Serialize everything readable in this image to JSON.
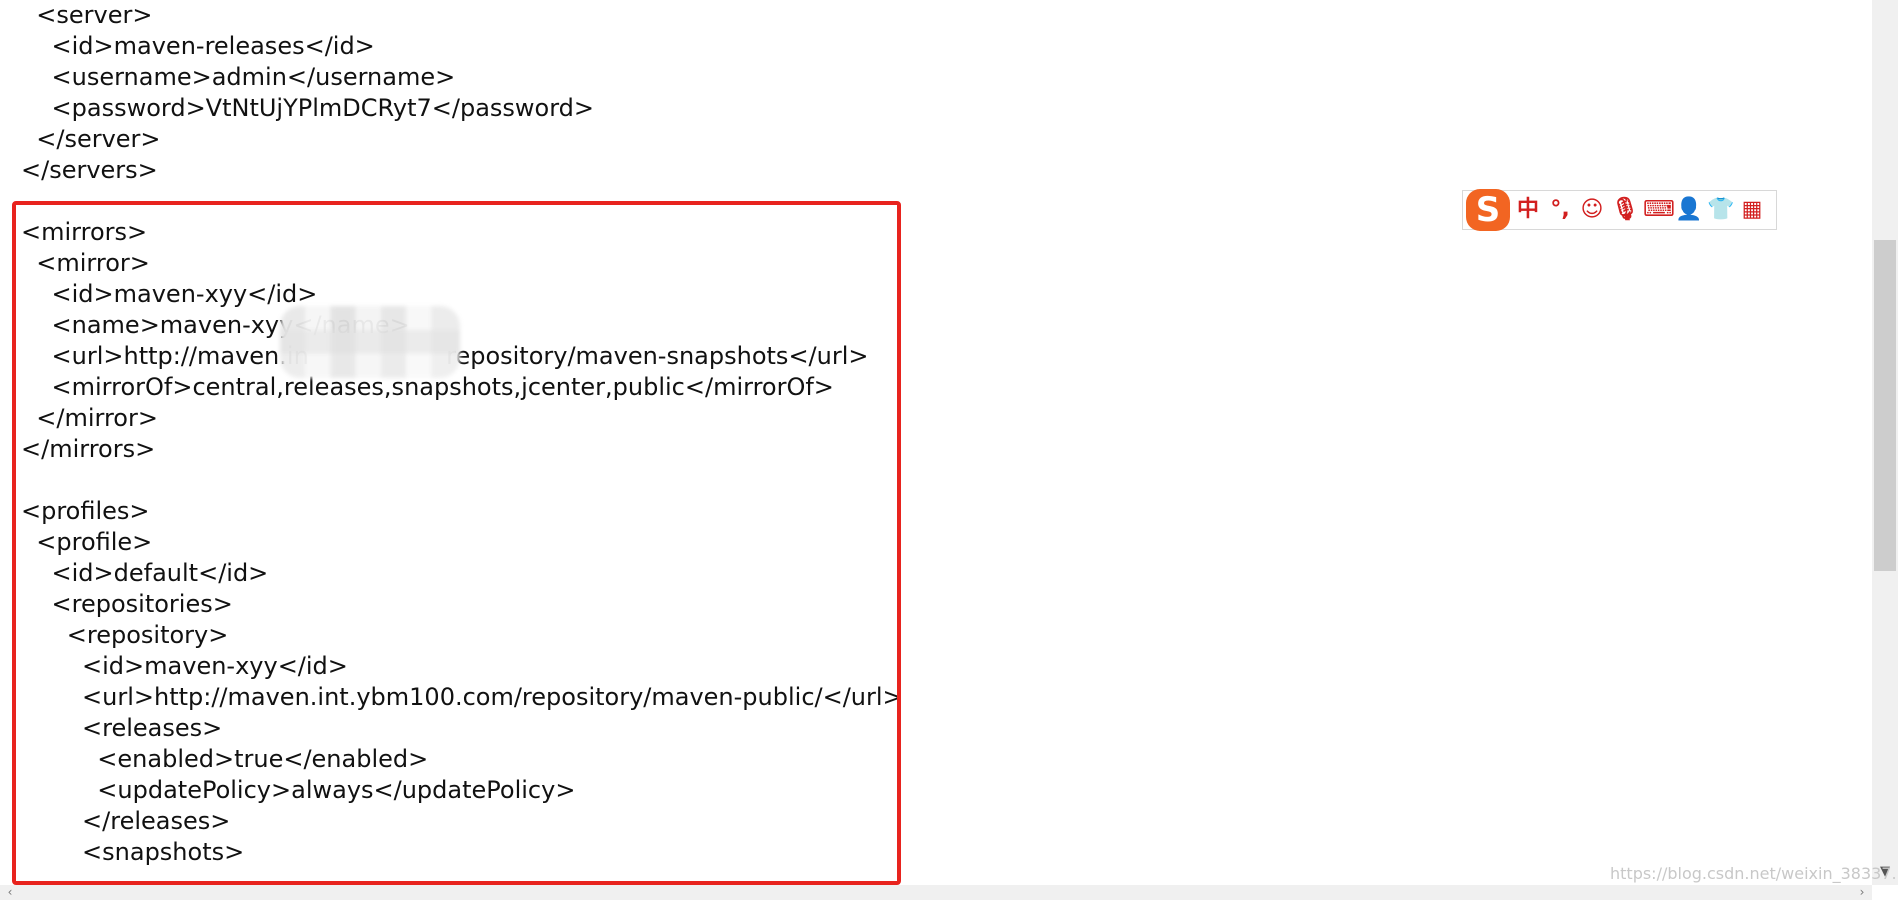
{
  "editor": {
    "lines": [
      "  <server>",
      "    <id>maven-releases</id>",
      "    <username>admin</username>",
      "    <password>VtNtUjYPlmDCRyt7</password>",
      "  </server>",
      "</servers>",
      "",
      "<mirrors>",
      "  <mirror>",
      "    <id>maven-xyy</id>",
      "    <name>maven-xyy</name>",
      "    <url>http://maven.in                  repository/maven-snapshots</url>",
      "    <mirrorOf>central,releases,snapshots,jcenter,public</mirrorOf>",
      "  </mirror>",
      "</mirrors>",
      "",
      "<profiles>",
      "  <profile>",
      "    <id>default</id>",
      "    <repositories>",
      "      <repository>",
      "        <id>maven-xyy</id>",
      "        <url>http://maven.int.ybm100.com/repository/maven-public/</url>",
      "        <releases>",
      "          <enabled>true</enabled>",
      "          <updatePolicy>always</updatePolicy>",
      "        </releases>",
      "        <snapshots>"
    ]
  },
  "ime_toolbar": {
    "logo": "S",
    "buttons": [
      {
        "label": "中",
        "icon": "chinese-mode-icon"
      },
      {
        "label": "°,",
        "icon": "punctuation-icon"
      },
      {
        "label": "☺",
        "icon": "emoji-icon"
      },
      {
        "label": "🎙",
        "icon": "microphone-icon"
      },
      {
        "label": "⌨",
        "icon": "keyboard-icon"
      },
      {
        "label": "👤",
        "icon": "user-icon"
      },
      {
        "label": "👕",
        "icon": "skin-icon"
      },
      {
        "label": "▦",
        "icon": "toolbox-icon"
      }
    ]
  },
  "watermark": "https://blog.csdn.net/weixin_38337...",
  "colors": {
    "highlight_border": "#e8231e",
    "ime_accent": "#d21f1f",
    "ime_logo": "#f26522"
  }
}
